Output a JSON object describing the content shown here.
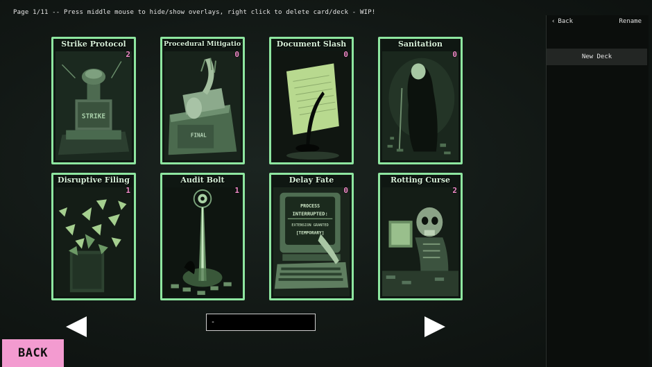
{
  "page_info": "Page 1/11  -- Press middle mouse to hide/show overlays, right click to delete card/deck - WIP!",
  "cards": [
    {
      "title": "Strike Protocol",
      "count": "2",
      "art": "rubber-stamp"
    },
    {
      "title": "Procedural Mitigation",
      "count": "0",
      "art": "file-box-hand"
    },
    {
      "title": "Document Slash",
      "count": "0",
      "art": "slashed-document"
    },
    {
      "title": "Sanitation",
      "count": "0",
      "art": "cloaked-figure"
    },
    {
      "title": "Disruptive Filing",
      "count": "1",
      "art": "exploding-papers"
    },
    {
      "title": "Audit Bolt",
      "count": "1",
      "art": "light-bolt"
    },
    {
      "title": "Delay Fate",
      "count": "0",
      "art": "crt-computer"
    },
    {
      "title": "Rotting Curse",
      "count": "2",
      "art": "skeleton-at-desk"
    }
  ],
  "crt_text": [
    "PROCESS",
    "INTERRUPTED:",
    "EXTENSION GRANTED",
    "[TEMPORARY]"
  ],
  "stamp_text": "STRIKE",
  "box_text": "FINAL",
  "deck_name_input": {
    "value": "-"
  },
  "back_button": "BACK",
  "side_panel": {
    "back": "Back",
    "rename": "Rename",
    "decks": [
      "New Deck"
    ]
  },
  "colors": {
    "card_border": "#8ee6a0",
    "count": "#f08ac8",
    "back_button": "#f39bd0"
  }
}
